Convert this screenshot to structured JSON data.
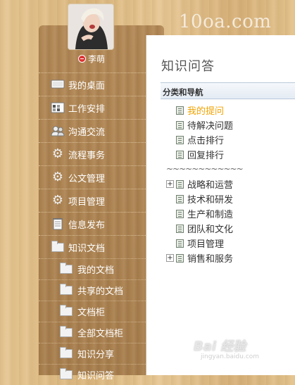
{
  "watermark": "10oa.com",
  "user": {
    "name": "李萌"
  },
  "menu": [
    {
      "label": "我的桌面",
      "icon": "monitor-icon"
    },
    {
      "label": "工作安排",
      "icon": "calendar-icon"
    },
    {
      "label": "沟通交流",
      "icon": "people-icon"
    },
    {
      "label": "流程事务",
      "icon": "gear-icon"
    },
    {
      "label": "公文管理",
      "icon": "gear-icon"
    },
    {
      "label": "项目管理",
      "icon": "gear-icon"
    },
    {
      "label": "信息发布",
      "icon": "notepad-icon"
    },
    {
      "label": "知识文档",
      "icon": "folder-icon"
    }
  ],
  "submenu": [
    {
      "label": "我的文档"
    },
    {
      "label": "共享的文档"
    },
    {
      "label": "文档柜"
    },
    {
      "label": "全部文档柜"
    },
    {
      "label": "知识分享"
    },
    {
      "label": "知识问答"
    }
  ],
  "panel": {
    "title": "知识问答",
    "section": "分类和导航",
    "quick_links": [
      {
        "label": "我的提问",
        "active": true
      },
      {
        "label": "待解决问题",
        "active": false
      },
      {
        "label": "点击排行",
        "active": false
      },
      {
        "label": "回复排行",
        "active": false
      }
    ],
    "separator": "~~~~~~~~~~~~",
    "categories": [
      {
        "label": "战略和运营",
        "expandable": true
      },
      {
        "label": "技术和研发",
        "expandable": false
      },
      {
        "label": "生产和制造",
        "expandable": false
      },
      {
        "label": "团队和文化",
        "expandable": false
      },
      {
        "label": "项目管理",
        "expandable": false
      },
      {
        "label": "销售和服务",
        "expandable": true
      }
    ]
  },
  "baidu_watermark": {
    "brand": "Bai 经验",
    "url": "jingyan.baidu.com"
  },
  "colors": {
    "active_link": "#f0a300",
    "sidebar": "#a9804f",
    "panel_bg": "#ffffff"
  }
}
